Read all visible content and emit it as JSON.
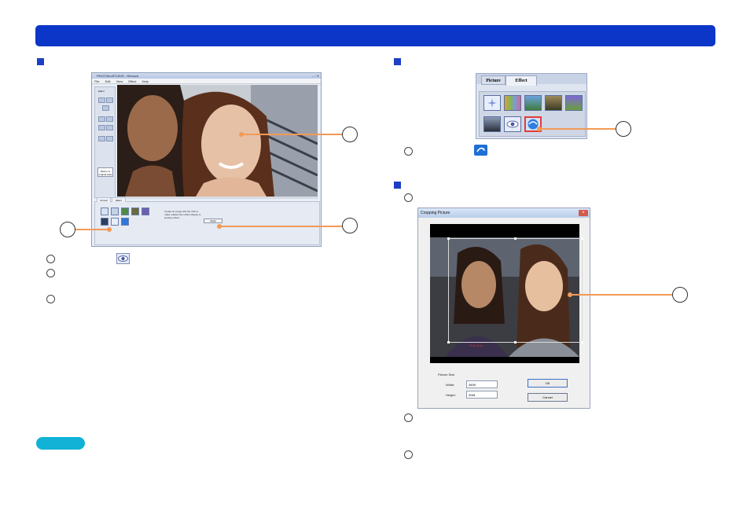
{
  "colors": {
    "header_bar": "#0b36c8",
    "callout": "#f29a56",
    "note_pill": "#12b2d6",
    "selected_effect_border": "#e23b3b"
  },
  "app_window": {
    "title": "PHOTOfunSTUDIO - Retouch",
    "menu": [
      "File",
      "Edit",
      "View",
      "Effect",
      "Help"
    ],
    "tool_label": "Effect",
    "original_button": "Return to original state",
    "tabs": [
      "Correct",
      "Effect"
    ],
    "instruction": "Create an image with the click to make realistic lens effect (Apply) to produce effect.",
    "apply_button": "Apply"
  },
  "effect_panel": {
    "tabs": [
      "Picture",
      "Effect"
    ],
    "selected_effect": "wide-conversion"
  },
  "crop_dialog": {
    "title": "Cropping Picture",
    "close": "×",
    "picture_size_label": "Picture Size",
    "width_label": "Width:",
    "width_value": "2609",
    "height_label": "Height:",
    "height_value": "2061",
    "ok": "OK",
    "cancel": "Cancel",
    "watermark": "Fine Sina"
  },
  "icons": {
    "eye_effect": "eye-icon",
    "wide_conversion": "blue-arrows-icon"
  }
}
